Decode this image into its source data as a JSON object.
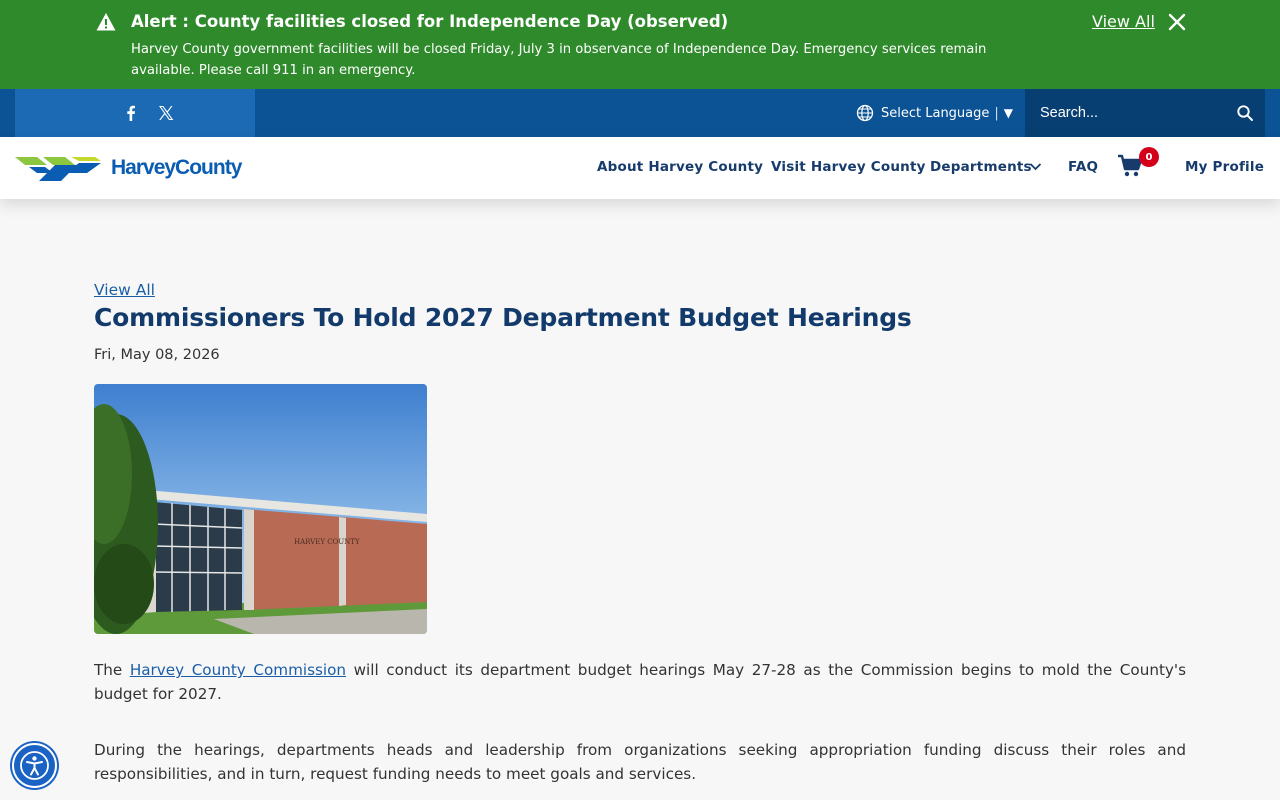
{
  "alert": {
    "title": "Alert : County facilities closed for Independence Day (observed)",
    "text": "Harvey County government facilities will be closed Friday, July 3 in observance of Independence Day. Emergency services remain available. Please call 911 in an emergency.",
    "view_all": "View All"
  },
  "utility": {
    "language_label": "Select Language",
    "language_separator": "|",
    "language_caret": "▼",
    "search_placeholder": "Search..."
  },
  "header": {
    "logo_text": "HarveyCounty",
    "nav": {
      "about": "About Harvey County",
      "visit": "Visit Harvey County",
      "departments": "Departments",
      "faq": "FAQ",
      "profile": "My Profile"
    },
    "cart_count": "0"
  },
  "article": {
    "view_all": "View All",
    "title": "Commissioners To Hold 2027 Department Budget Hearings",
    "date": "Fri, May 08, 2026",
    "p1_before": "The ",
    "p1_link": "Harvey County Commission",
    "p1_after": " will conduct its department budget hearings May 27-28 as the Commission begins to mold the County's budget for 2027.",
    "p2": "During the hearings, departments heads and leadership from organizations seeking appropriation funding discuss their roles and responsibilities, and in turn, request funding needs to meet goals and services.",
    "photo_sign": "HARVEY COUNTY"
  },
  "colors": {
    "alert_green": "#2f8a2b",
    "utility_blue": "#0b5394",
    "title_navy": "#123a6b",
    "link_blue": "#1a5ea8",
    "badge_red": "#d4001a"
  }
}
